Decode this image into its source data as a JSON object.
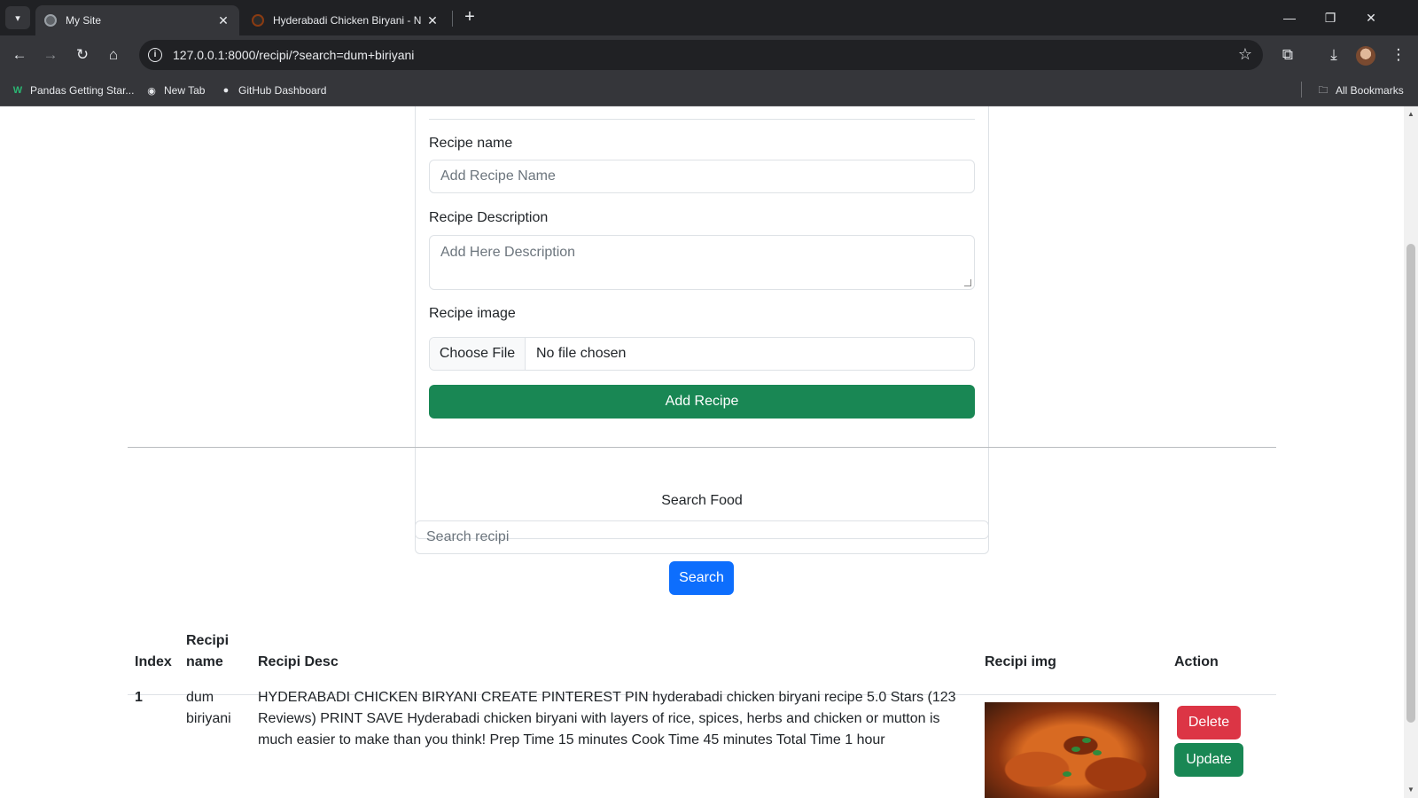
{
  "browser": {
    "tabs": [
      {
        "title": "My Site",
        "active": true
      },
      {
        "title": "Hyderabadi Chicken Biryani - N",
        "active": false
      }
    ],
    "url": "127.0.0.1:8000/recipi/?search=dum+biriyani",
    "bookmarks": [
      {
        "label": "Pandas Getting Star...",
        "icon": "w-logo-icon"
      },
      {
        "label": "New Tab",
        "icon": "globe-icon"
      },
      {
        "label": "GitHub Dashboard",
        "icon": "github-icon"
      }
    ],
    "all_bookmarks": "All Bookmarks"
  },
  "form": {
    "name_label": "Recipe name",
    "name_placeholder": "Add Recipe Name",
    "desc_label": "Recipe Description",
    "desc_placeholder": "Add Here Description",
    "image_label": "Recipe image",
    "file_button": "Choose File",
    "file_status": "No file chosen",
    "submit_label": "Add Recipe"
  },
  "search": {
    "label": "Search Food",
    "placeholder": "Search recipi",
    "button": "Search"
  },
  "table": {
    "headers": {
      "index": "Index",
      "name": "Recipi name",
      "desc": "Recipi Desc",
      "img": "Recipi img",
      "action": "Action"
    },
    "rows": [
      {
        "index": "1",
        "name": "dum biriyani",
        "desc": "HYDERABADI CHICKEN BIRYANI CREATE PINTEREST PIN hyderabadi chicken biryani recipe 5.0 Stars (123 Reviews) PRINT SAVE Hyderabadi chicken biryani with layers of rice, spices, herbs and chicken or mutton is much easier to make than you think! Prep Time 15 minutes Cook Time 45 minutes Total Time 1 hour",
        "delete_label": "Delete",
        "update_label": "Update"
      }
    ]
  },
  "colors": {
    "success": "#198754",
    "primary": "#0d6efd",
    "danger": "#dc3545"
  }
}
